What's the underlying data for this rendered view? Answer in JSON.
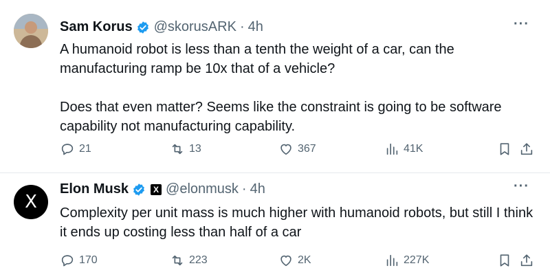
{
  "tweets": [
    {
      "name": "Sam Korus",
      "handle": "@skorusARK",
      "dot": "·",
      "time": "4h",
      "more": "···",
      "paragraphs": [
        "A humanoid robot is less than a tenth the weight of a car, can the manufacturing ramp be 10x that of a vehicle?",
        "Does that even matter? Seems like the constraint is going to be software capability not manufacturing capability."
      ],
      "replies": "21",
      "retweets": "13",
      "likes": "367",
      "views": "41K"
    },
    {
      "name": "Elon Musk",
      "badge": "X",
      "avatar_glyph": "X",
      "handle": "@elonmusk",
      "dot": "·",
      "time": "4h",
      "more": "···",
      "paragraphs": [
        "Complexity per unit mass is much higher with humanoid robots, but still I think it ends up costing less than half of a car"
      ],
      "replies": "170",
      "retweets": "223",
      "likes": "2K",
      "views": "227K"
    }
  ],
  "colors": {
    "verified": "#1d9bf0",
    "muted": "#536471",
    "text": "#0f1419"
  },
  "icons": [
    "reply-icon",
    "retweet-icon",
    "like-icon",
    "views-icon",
    "bookmark-icon",
    "share-icon",
    "verified-icon"
  ]
}
